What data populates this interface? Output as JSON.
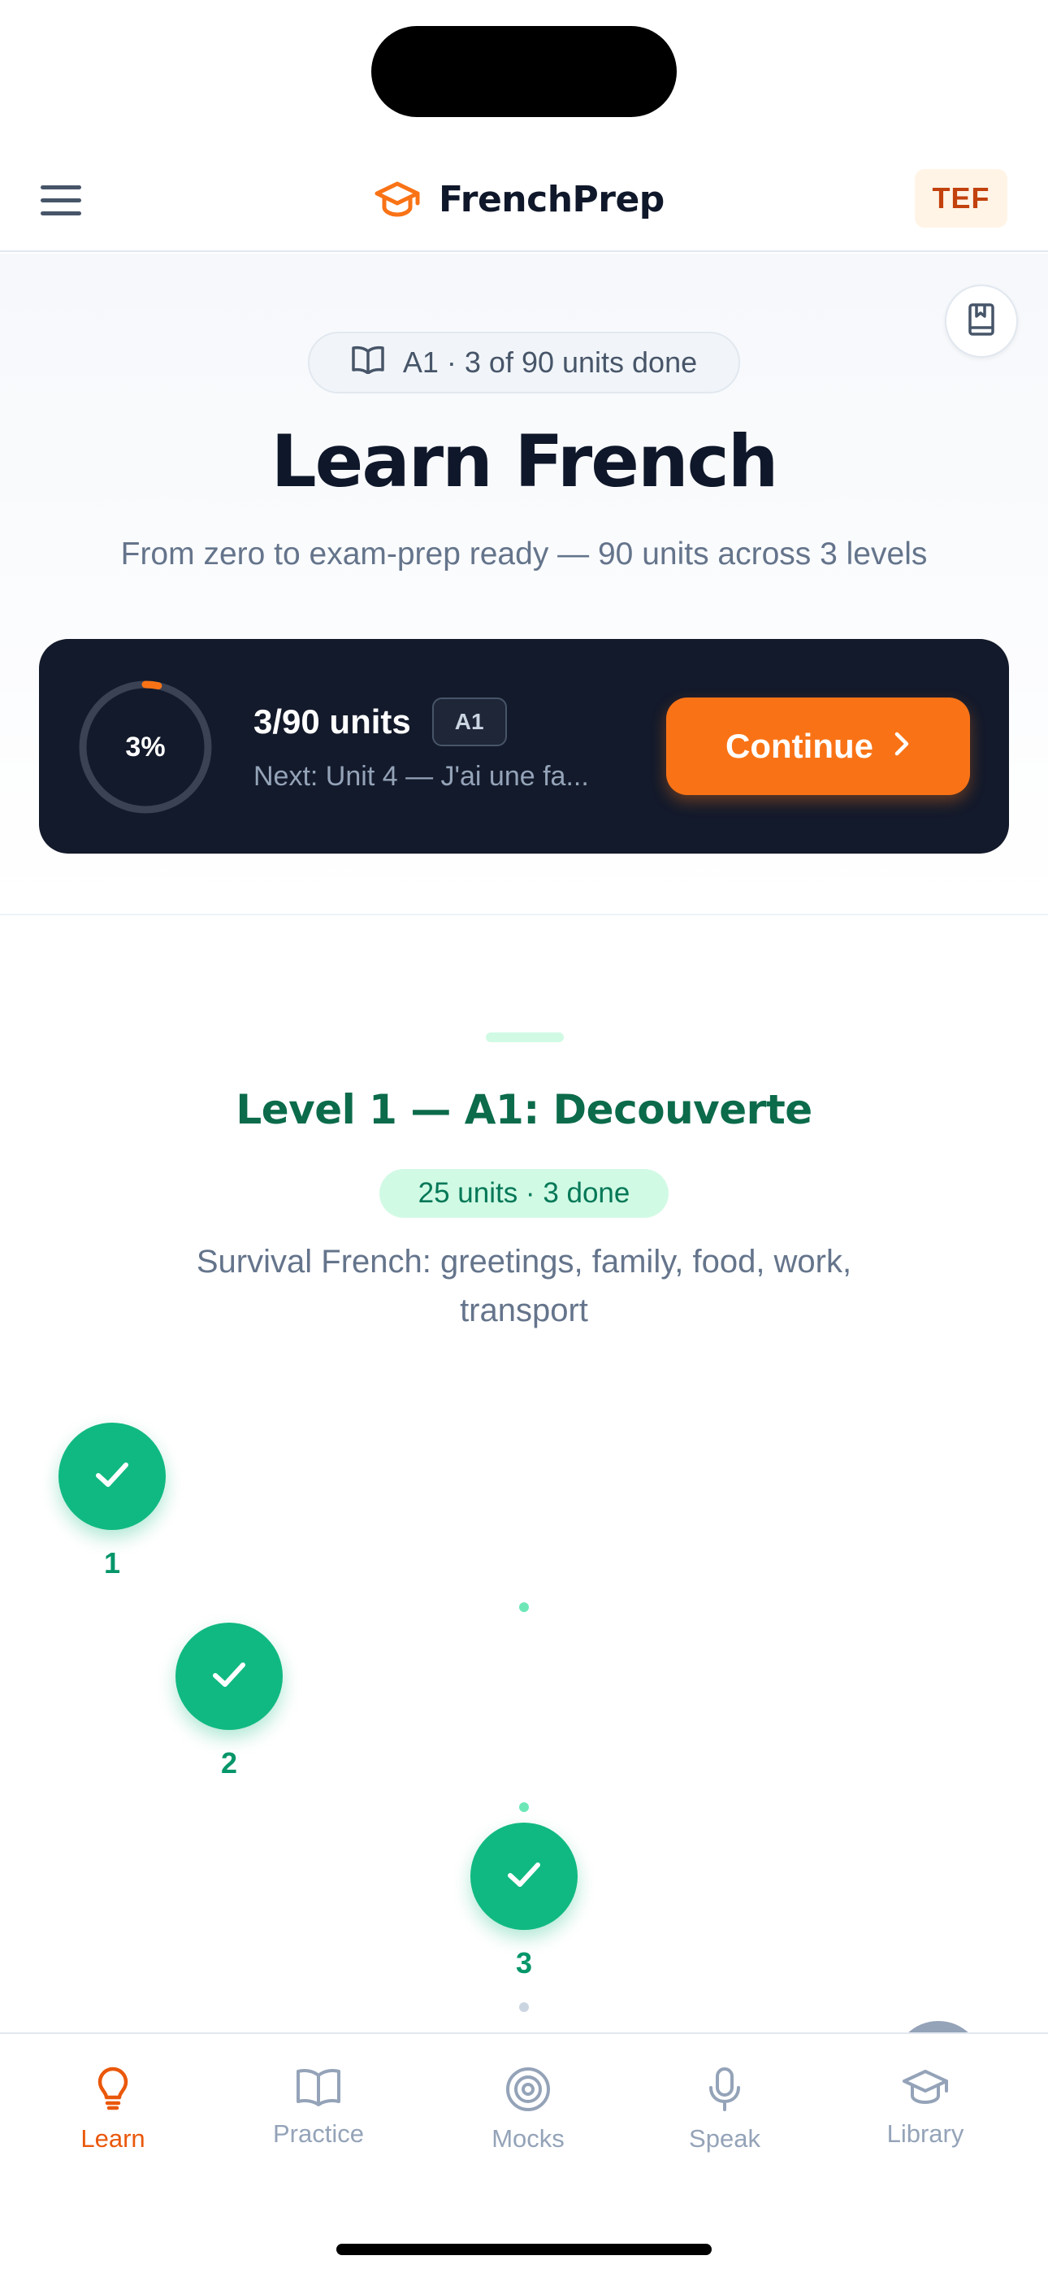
{
  "header": {
    "brand": "FrenchPrep",
    "exam_badge": "TEF",
    "menu_icon": "hamburger-menu-icon",
    "brand_icon": "graduation-cap-icon"
  },
  "hero": {
    "progress_pill": "A1 · 3 of 90 units done",
    "title": "Learn French",
    "subtitle": "From zero to exam-prep ready — 90 units across 3 levels"
  },
  "progress_card": {
    "percent_label": "3%",
    "percent_value": 0.033,
    "units_text": "3/90 units",
    "level_chip": "A1",
    "next_text": "Next: Unit 4 — J'ai une fa...",
    "continue_label": "Continue"
  },
  "level": {
    "title": "Level 1 — A1: Decouverte",
    "count": "25 units · 3 done",
    "description": "Survival French: greetings, family, food, work, transport",
    "units": [
      {
        "number": "1",
        "status": "done"
      },
      {
        "number": "2",
        "status": "done"
      },
      {
        "number": "3",
        "status": "done"
      }
    ]
  },
  "tabs": [
    {
      "label": "Learn",
      "icon": "lightbulb-icon",
      "active": true
    },
    {
      "label": "Practice",
      "icon": "open-book-icon",
      "active": false
    },
    {
      "label": "Mocks",
      "icon": "target-icon",
      "active": false
    },
    {
      "label": "Speak",
      "icon": "microphone-icon",
      "active": false
    },
    {
      "label": "Library",
      "icon": "graduation-cap-icon",
      "active": false
    }
  ],
  "colors": {
    "accent": "#f97316",
    "success": "#10b981",
    "dark_card": "#131a2b",
    "level_title": "#0b6b4a"
  }
}
